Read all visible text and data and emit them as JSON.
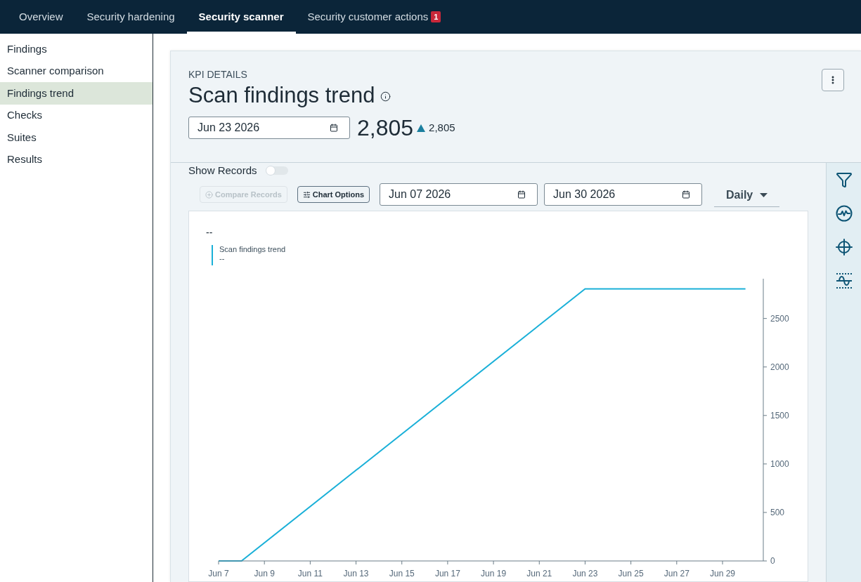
{
  "nav_tabs": [
    {
      "label": "Overview",
      "selected": false
    },
    {
      "label": "Security hardening",
      "selected": false
    },
    {
      "label": "Security scanner",
      "selected": true
    },
    {
      "label": "Security customer actions",
      "selected": false,
      "badge": "1"
    }
  ],
  "sidebar": {
    "items": [
      {
        "label": "Findings",
        "selected": false
      },
      {
        "label": "Scanner comparison",
        "selected": false
      },
      {
        "label": "Findings trend",
        "selected": true
      },
      {
        "label": "Checks",
        "selected": false
      },
      {
        "label": "Suites",
        "selected": false
      },
      {
        "label": "Results",
        "selected": false
      }
    ]
  },
  "kpi": {
    "eyebrow": "KPI DETAILS",
    "title": "Scan findings trend",
    "date": "Jun 23 2026",
    "value": "2,805",
    "increase": true,
    "change": "2,805"
  },
  "controls": {
    "show_records": {
      "label": "Show Records",
      "on": false
    },
    "compare_button": {
      "label": "Compare Records",
      "disabled": true
    },
    "chart_options_button": {
      "label": "Chart Options"
    },
    "start_date": "Jun 07 2026",
    "end_date": "Jun 30 2026",
    "interval": "Daily"
  },
  "chart": {
    "header_value": "--",
    "legend_value": "--",
    "chart_data": {
      "type": "line",
      "categories": [
        "Jun 7",
        null,
        "Jun 9",
        null,
        "Jun 11",
        null,
        "Jun 13",
        null,
        "Jun 15",
        null,
        "Jun 17",
        null,
        "Jun 19",
        null,
        "Jun 21",
        null,
        "Jun 23",
        null,
        "Jun 25",
        null,
        "Jun 27",
        null,
        "Jun 29",
        null
      ],
      "series": [
        {
          "name": "Scan findings trend",
          "color": "#1ab0d8",
          "values": [
            0,
            0,
            null,
            null,
            null,
            null,
            null,
            null,
            null,
            null,
            null,
            null,
            null,
            null,
            null,
            null,
            2805,
            2805,
            2805,
            2805,
            2805,
            2805,
            2805,
            2805
          ]
        }
      ],
      "ylim": [
        0,
        2910
      ],
      "yticks": [
        0,
        500,
        1000,
        1500,
        2000,
        2500
      ]
    }
  }
}
